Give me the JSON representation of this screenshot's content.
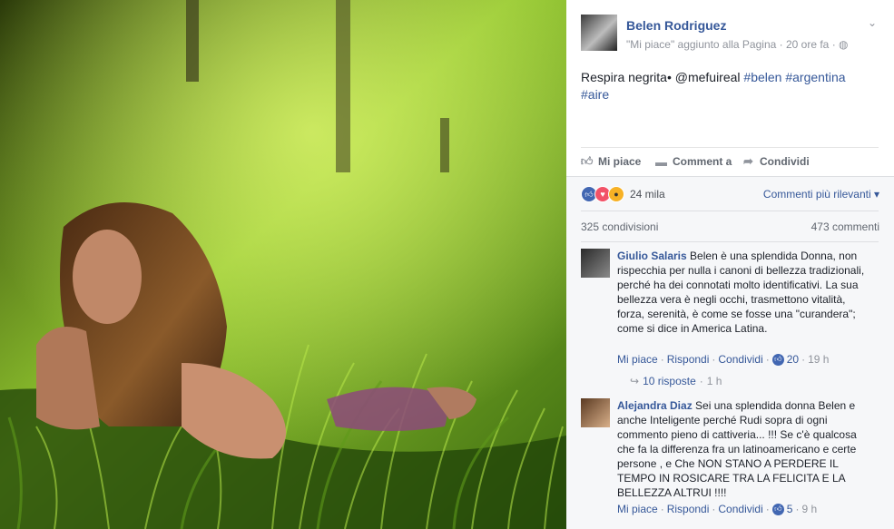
{
  "post": {
    "page_name": "Belen Rodriguez",
    "meta_text": "\"Mi piace\" aggiunto alla Pagina",
    "time": "20 ore fa",
    "caption_text": "Respira negrita• @mefuireal ",
    "hashtags": [
      "#belen",
      "#argentina",
      "#aire"
    ]
  },
  "actions": {
    "like": "Mi piace",
    "comment": "Comment a",
    "share": "Condividi"
  },
  "feedback": {
    "reaction_count": "24 mila",
    "sort_label": "Commenti più rilevanti",
    "shares": "325 condivisioni",
    "comments_count": "473 commenti"
  },
  "comments": [
    {
      "author": "Giulio Salaris",
      "text": "Belen è una splendida Donna, non rispecchia per nulla i canoni di bellezza tradizionali, perché ha dei connotati molto identificativi. La sua bellezza vera è negli occhi, trasmettono vitalità, forza, serenità, è come se fosse una \"curandera\"; come si dice in America Latina.",
      "like": "Mi piace",
      "reply": "Rispondi",
      "share": "Condividi",
      "likes": "20",
      "time": "19 h",
      "replies_label": "10 risposte",
      "replies_time": "1 h"
    },
    {
      "author": "Alejandra Diaz",
      "text": "Sei una splendida donna Belen e anche Inteligente perché Rudi sopra di ogni commento pieno di cattiveria... !!! Se c'è qualcosa che fa la differenza fra un latinoamericano e certe persone , e Che NON STANO A PERDERE IL TEMPO IN ROSICARE TRA LA FELICITA E LA BELLEZZA ALTRUI !!!!",
      "like": "Mi piace",
      "reply": "Rispondi",
      "share": "Condividi",
      "likes": "5",
      "time": "9 h"
    }
  ],
  "colors": {
    "link": "#365899",
    "grass": "#7fb626",
    "feedback_bg": "#f6f7f9"
  },
  "icons": [
    "chevron-down-icon",
    "globe-icon",
    "thumbs-up-icon",
    "comment-icon",
    "share-icon",
    "like-reaction-icon",
    "love-reaction-icon",
    "wow-reaction-icon",
    "reply-arrow-icon"
  ]
}
